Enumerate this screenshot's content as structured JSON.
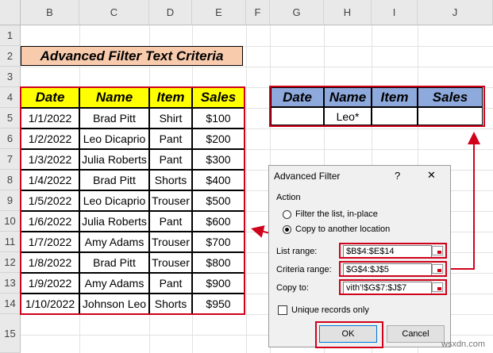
{
  "columns": [
    "B",
    "C",
    "D",
    "E",
    "F",
    "G",
    "H",
    "I",
    "J"
  ],
  "rows": [
    "1",
    "2",
    "3",
    "4",
    "5",
    "6",
    "7",
    "8",
    "9",
    "10",
    "11",
    "12",
    "13",
    "14",
    "15"
  ],
  "title": "Advanced Filter Text Criteria",
  "data_table": {
    "headers": [
      "Date",
      "Name",
      "Item",
      "Sales"
    ],
    "rows": [
      [
        "1/1/2022",
        "Brad Pitt",
        "Shirt",
        "$100"
      ],
      [
        "1/2/2022",
        "Leo Dicaprio",
        "Pant",
        "$200"
      ],
      [
        "1/3/2022",
        "Julia Roberts",
        "Pant",
        "$300"
      ],
      [
        "1/4/2022",
        "Brad Pitt",
        "Shorts",
        "$400"
      ],
      [
        "1/5/2022",
        "Leo Dicaprio",
        "Trouser",
        "$500"
      ],
      [
        "1/6/2022",
        "Julia Roberts",
        "Pant",
        "$600"
      ],
      [
        "1/7/2022",
        "Amy Adams",
        "Trouser",
        "$700"
      ],
      [
        "1/8/2022",
        "Brad Pitt",
        "Trouser",
        "$800"
      ],
      [
        "1/9/2022",
        "Amy Adams",
        "Pant",
        "$900"
      ],
      [
        "1/10/2022",
        "Johnson Leo",
        "Shorts",
        "$950"
      ]
    ]
  },
  "criteria_table": {
    "headers": [
      "Date",
      "Name",
      "Item",
      "Sales"
    ],
    "row": [
      "",
      "Leo*",
      "",
      ""
    ]
  },
  "dialog": {
    "title": "Advanced Filter",
    "help": "?",
    "close": "✕",
    "action_label": "Action",
    "option_filter": "Filter the list, in-place",
    "option_copy": "Copy to another location",
    "list_range_label": "List range:",
    "list_range_value": "$B$4:$E$14",
    "criteria_range_label": "Criteria range:",
    "criteria_range_value": "$G$4:$J$5",
    "copy_to_label": "Copy to:",
    "copy_to_value": "vith'!$G$7:$J$7",
    "unique_label": "Unique records only",
    "ok_label": "OK",
    "cancel_label": "Cancel"
  },
  "watermark": "wsxdn.com",
  "colors": {
    "accent_red": "#d0021b",
    "yellow_header": "#ffff00",
    "blue_header": "#8ea9db",
    "title_fill": "#f8cbad"
  }
}
